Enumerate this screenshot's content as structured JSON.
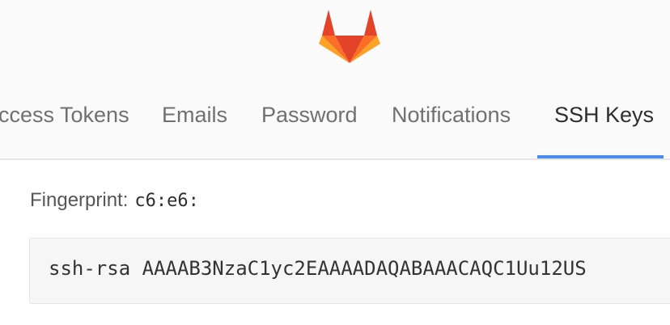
{
  "brand": {
    "logo_icon": "gitlab-fox-icon",
    "colors": {
      "dark": "#e24329",
      "mid": "#fc6d26",
      "light": "#fca326"
    }
  },
  "tabs": [
    {
      "label": "ccess Tokens",
      "active": false
    },
    {
      "label": "Emails",
      "active": false
    },
    {
      "label": "Password",
      "active": false
    },
    {
      "label": "Notifications",
      "active": false
    },
    {
      "label": "SSH Keys",
      "active": true
    }
  ],
  "accent_color": "#4a8bee",
  "key": {
    "fingerprint_label": "Fingerprint:",
    "fingerprint_value": "c6:e6:",
    "public_key": "ssh-rsa AAAAB3NzaC1yc2EAAAADAQABAAACAQC1Uu12US"
  }
}
